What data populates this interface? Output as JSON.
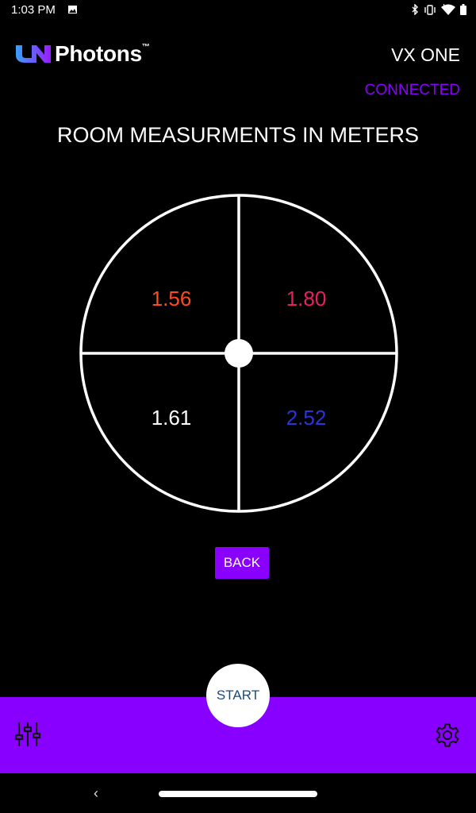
{
  "status_bar": {
    "time": "1:03 PM",
    "icons": [
      "image-icon",
      "bluetooth-icon",
      "vibrate-icon",
      "wifi-icon",
      "battery-icon"
    ]
  },
  "header": {
    "brand": "Photons",
    "brand_mark": "™",
    "device_name": "VX ONE",
    "connection_status": "CONNECTED"
  },
  "main": {
    "title": "ROOM MEASURMENTS IN METERS",
    "quadrants": {
      "top_left": "1.56",
      "top_right": "1.80",
      "bottom_left": "1.61",
      "bottom_right": "2.52"
    },
    "back_label": "BACK"
  },
  "bottom_bar": {
    "start_label": "START",
    "left_icon": "mixer-sliders-icon",
    "right_icon": "gear-icon"
  },
  "nav": {
    "back_glyph": "‹"
  },
  "colors": {
    "accent": "#8a00ff",
    "value_top_left": "#ff4a1c",
    "value_top_right": "#ea1f63",
    "value_bottom_left": "#ffffff",
    "value_bottom_right": "#2a35d8"
  }
}
